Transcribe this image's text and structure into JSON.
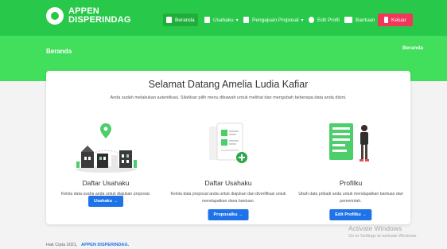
{
  "brand": {
    "line1": "APPEN",
    "line2": "DISPERINDAG"
  },
  "nav": {
    "beranda": "Beranda",
    "usahaku": "Usahaku",
    "pengajuan": "Pengajuan Proposal",
    "profil": "Edit Profil",
    "bantuan": "Bantuan",
    "keluar": "Keluar"
  },
  "subheader": {
    "title": "Beranda",
    "crumb": "Beranda"
  },
  "welcome": {
    "title": "Selamat Datang Amelia Ludia Kafiar",
    "intro": "Anda sudah melakukan autentikasi. Silahkan pilih menu dibawah untuk melihat dan mengubah beberapa data anda disini."
  },
  "cards": [
    {
      "title": "Daftar Usahaku",
      "desc": "Kelola data usaha anda untuk diajukan proposal.",
      "button": "Usahaku →"
    },
    {
      "title": "Daftar Usahaku",
      "desc": "Kelola data proposal anda untuk diajukan dan diverifikasi untuk mendapatkan dana bantuan.",
      "button": "Proposalku →"
    },
    {
      "title": "Profilku",
      "desc": "Ubah data pribadi anda untuk mendapatkan bantuan dari pemerintah.",
      "button": "Edit Profilku →"
    }
  ],
  "footer": {
    "text": "Hak Cipta 2021",
    "brand": "APPEN DISPERINDAG."
  },
  "watermark": {
    "line1": "Activate Windows",
    "line2": "Go to Settings to activate Windows."
  },
  "colors": {
    "primary": "#28c94a",
    "banner": "#41df5b",
    "button": "#1e73e8",
    "logout": "#f2385a"
  }
}
